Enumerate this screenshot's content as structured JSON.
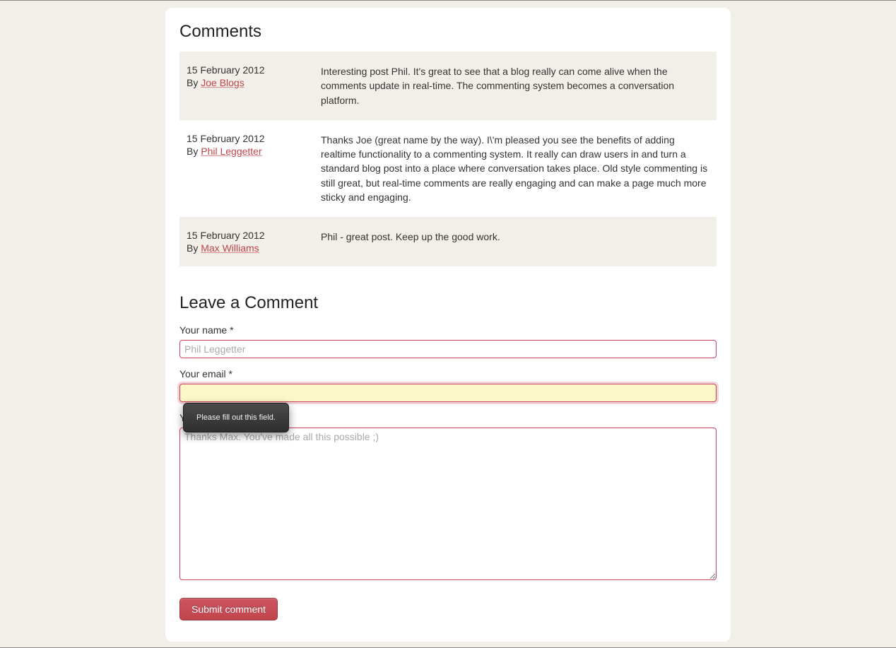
{
  "headings": {
    "comments": "Comments",
    "leave": "Leave a Comment"
  },
  "by_prefix": "By",
  "comments": [
    {
      "date": "15 February 2012",
      "author": "Joe Blogs",
      "text": "Interesting post Phil. It's great to see that a blog really can come alive when the comments update in real-time. The commenting system becomes a conversation platform."
    },
    {
      "date": "15 February 2012",
      "author": "Phil Leggetter",
      "text": "Thanks Joe (great name by the way). I\\'m pleased you see the benefits of adding realtime functionality to a commenting system. It really can draw users in and turn a standard blog post into a place where conversation takes place. Old style commenting is still great, but real-time comments are really engaging and can make a page much more sticky and engaging."
    },
    {
      "date": "15 February 2012",
      "author": "Max Williams",
      "text": "Phil - great post. Keep up the good work."
    }
  ],
  "form": {
    "name": {
      "label": "Your name *",
      "placeholder": "Phil Leggetter",
      "value": ""
    },
    "email": {
      "label": "Your email *",
      "value": "",
      "tooltip": "Please fill out this field."
    },
    "comment": {
      "label": "Your comment *",
      "placeholder": "Thanks Max. You've made all this possible ;)",
      "value": ""
    },
    "submit": "Submit comment"
  }
}
